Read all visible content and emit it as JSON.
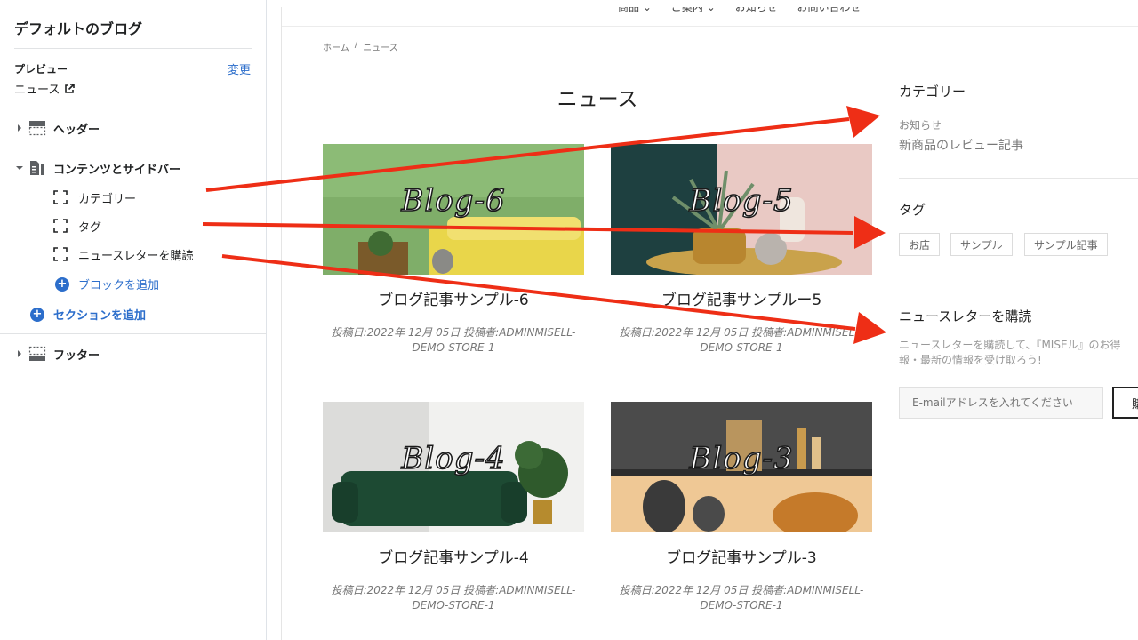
{
  "editor": {
    "title": "デフォルトのブログ",
    "preview_label": "プレビュー",
    "change_link": "変更",
    "preview_page": "ニュース",
    "sections": {
      "header": "ヘッダー",
      "content": "コンテンツとサイドバー",
      "footer": "フッター"
    },
    "blocks": [
      "カテゴリー",
      "タグ",
      "ニュースレターを購読"
    ],
    "add_block": "ブロックを追加",
    "add_section": "セクションを追加"
  },
  "preview": {
    "nav": [
      "商品 ⌄",
      "ご案内 ⌄",
      "お知らせ",
      "お問い合わせ"
    ],
    "breadcrumb": [
      "ホーム",
      "/",
      "ニュース"
    ],
    "heading": "ニュース",
    "posts": [
      {
        "image_label": "Blog-6",
        "title": "ブログ記事サンプル-6",
        "meta": "投稿日:2022年 12月 05日 投稿者:ADMINMISELL-DEMO-STORE-1"
      },
      {
        "image_label": "Blog-5",
        "title": "ブログ記事サンプルー5",
        "meta": "投稿日:2022年 12月 05日 投稿者:ADMINMISELL-DEMO-STORE-1"
      },
      {
        "image_label": "Blog-4",
        "title": "ブログ記事サンプル-4",
        "meta": "投稿日:2022年 12月 05日 投稿者:ADMINMISELL-DEMO-STORE-1"
      },
      {
        "image_label": "Blog-3",
        "title": "ブログ記事サンプル-3",
        "meta": "投稿日:2022年 12月 05日 投稿者:ADMINMISELL-DEMO-STORE-1"
      }
    ],
    "sidebar": {
      "category_heading": "カテゴリー",
      "categories": [
        "お知らせ",
        "新商品のレビュー記事"
      ],
      "tag_heading": "タグ",
      "tags": [
        "お店",
        "サンプル",
        "サンプル記事"
      ],
      "newsletter_heading": "ニュースレターを購読",
      "newsletter_desc_1": "ニュースレターを購読して、『MISEル』のお得",
      "newsletter_desc_2": "報・最新の情報を受け取ろう!",
      "email_placeholder": "E-mailアドレスを入れてください",
      "subscribe_label": "購"
    }
  },
  "colors": {
    "accent_blue": "#2c6ecb",
    "arrow_red": "#ee2e16"
  }
}
